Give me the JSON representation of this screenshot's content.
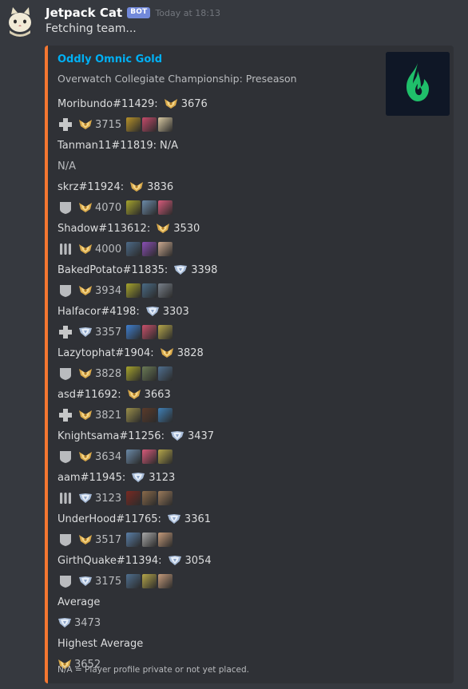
{
  "bot": {
    "name": "Jetpack Cat",
    "tag": "BOT",
    "timestamp": "Today at 18:13",
    "message": "Fetching team..."
  },
  "embed": {
    "accent_color": "#f57731",
    "title": "Oddly Omnic Gold",
    "description": "Overwatch Collegiate Championship: Preseason",
    "thumbnail_icon": "flame-logo-icon",
    "players": [
      {
        "name": "Moribundo#11429:",
        "rank_icon": "master-rank-icon",
        "sr": "3676",
        "role": "support-icon",
        "sub_rank_icon": "master-rank-icon",
        "sub_sr": "3715",
        "heroes": [
          "hero-icon",
          "hero-icon",
          "hero-icon"
        ]
      },
      {
        "name": "Tanman11#11819:",
        "sr": "N/A",
        "na": true,
        "detail": "N/A"
      },
      {
        "name": "skrz#11924:",
        "rank_icon": "master-rank-icon",
        "sr": "3836",
        "role": "tank-icon",
        "sub_rank_icon": "master-rank-icon",
        "sub_sr": "4070",
        "heroes": [
          "hero-icon",
          "hero-icon",
          "hero-icon"
        ]
      },
      {
        "name": "Shadow#113612:",
        "rank_icon": "master-rank-icon",
        "sr": "3530",
        "role": "damage-icon",
        "sub_rank_icon": "master-rank-icon",
        "sub_sr": "4000",
        "heroes": [
          "hero-icon",
          "hero-icon",
          "hero-icon"
        ]
      },
      {
        "name": "BakedPotato#11835:",
        "rank_icon": "diamond-rank-icon",
        "sr": "3398",
        "role": "tank-icon",
        "sub_rank_icon": "master-rank-icon",
        "sub_sr": "3934",
        "heroes": [
          "hero-icon",
          "hero-icon",
          "hero-icon"
        ]
      },
      {
        "name": "Halfacor#4198:",
        "rank_icon": "diamond-rank-icon",
        "sr": "3303",
        "role": "support-icon",
        "sub_rank_icon": "diamond-rank-icon",
        "sub_sr": "3357",
        "heroes": [
          "hero-icon",
          "hero-icon",
          "hero-icon"
        ]
      },
      {
        "name": "Lazytophat#1904:",
        "rank_icon": "master-rank-icon",
        "sr": "3828",
        "role": "tank-icon",
        "sub_rank_icon": "master-rank-icon",
        "sub_sr": "3828",
        "heroes": [
          "hero-icon",
          "hero-icon",
          "hero-icon"
        ]
      },
      {
        "name": "asd#11692:",
        "rank_icon": "master-rank-icon",
        "sr": "3663",
        "role": "support-icon",
        "sub_rank_icon": "master-rank-icon",
        "sub_sr": "3821",
        "heroes": [
          "hero-icon",
          "hero-icon",
          "hero-icon"
        ]
      },
      {
        "name": "Knightsama#11256:",
        "rank_icon": "diamond-rank-icon",
        "sr": "3437",
        "role": "tank-icon",
        "sub_rank_icon": "master-rank-icon",
        "sub_sr": "3634",
        "heroes": [
          "hero-icon",
          "hero-icon",
          "hero-icon"
        ]
      },
      {
        "name": "aam#11945:",
        "rank_icon": "diamond-rank-icon",
        "sr": "3123",
        "role": "damage-icon",
        "sub_rank_icon": "diamond-rank-icon",
        "sub_sr": "3123",
        "heroes": [
          "hero-icon",
          "hero-icon",
          "hero-icon"
        ]
      },
      {
        "name": "UnderHood#11765:",
        "rank_icon": "diamond-rank-icon",
        "sr": "3361",
        "role": "tank-icon",
        "sub_rank_icon": "master-rank-icon",
        "sub_sr": "3517",
        "heroes": [
          "hero-icon",
          "hero-icon",
          "hero-icon"
        ]
      },
      {
        "name": "GirthQuake#11394:",
        "rank_icon": "diamond-rank-icon",
        "sr": "3054",
        "role": "tank-icon",
        "sub_rank_icon": "diamond-rank-icon",
        "sub_sr": "3175",
        "heroes": [
          "hero-icon",
          "hero-icon",
          "hero-icon"
        ]
      }
    ],
    "average_label": "Average",
    "average_rank_icon": "diamond-rank-icon",
    "average_sr": "3473",
    "highest_label": "Highest Average",
    "highest_rank_icon": "master-rank-icon",
    "highest_sr": "3652",
    "footer": "N/A = Player profile private or not yet placed."
  },
  "hero_colors": [
    [
      "#b8922a",
      "#c44a6a",
      "#d6c7a0"
    ],
    null,
    [
      "#a6a42c",
      "#6b8aa8",
      "#d65a7a"
    ],
    [
      "#4c6a88",
      "#8a4fb5",
      "#caa88f"
    ],
    [
      "#a6a42c",
      "#4a6b86",
      "#78808a"
    ],
    [
      "#3f7fd0",
      "#c8506a",
      "#b5a64a"
    ],
    [
      "#a6a42c",
      "#6a7a55",
      "#4f6f8f"
    ],
    [
      "#9a8f4a",
      "#5a3a2a",
      "#3f7fb5"
    ],
    [
      "#6b8aa8",
      "#d65a7a",
      "#b5a64a"
    ],
    [
      "#7a2a22",
      "#8a6a4a",
      "#9a7a5a"
    ],
    [
      "#5a7fa8",
      "#a8a8a8",
      "#c49a7a"
    ],
    [
      "#4f6f8f",
      "#b5a64a",
      "#c49a7a"
    ]
  ]
}
